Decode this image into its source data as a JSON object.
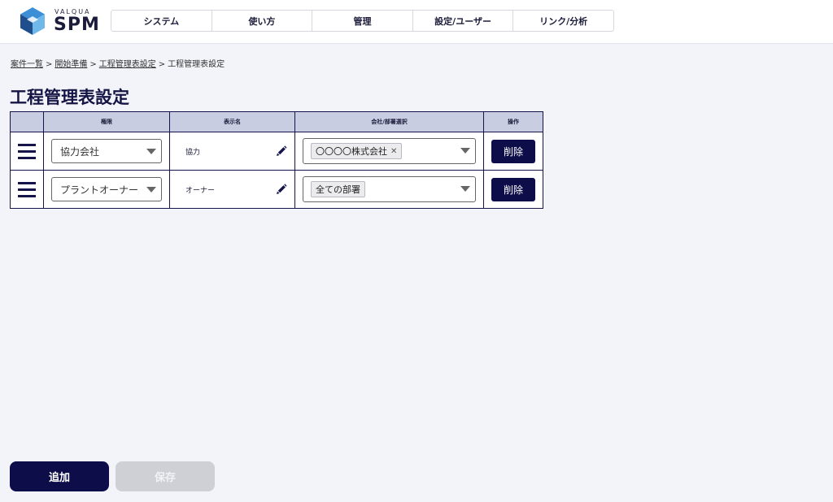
{
  "brand": {
    "sub": "VALQUA",
    "name": "SPM"
  },
  "nav": {
    "items": [
      {
        "label": "システム"
      },
      {
        "label": "使い方"
      },
      {
        "label": "管理"
      },
      {
        "label": "設定/ユーザー"
      },
      {
        "label": "リンク/分析"
      }
    ]
  },
  "breadcrumb": {
    "items": [
      {
        "label": "案件一覧"
      },
      {
        "label": "開始準備"
      },
      {
        "label": "工程管理表設定"
      },
      {
        "label": "工程管理表設定"
      }
    ],
    "separator": ">"
  },
  "page": {
    "title": "工程管理表設定"
  },
  "table": {
    "headers": [
      "",
      "権限",
      "表示名",
      "会社/部署選択",
      "操作"
    ],
    "rows": [
      {
        "role": "協力会社",
        "display_name": "協力",
        "tag": "〇〇〇〇株式会社",
        "tag_removable": true,
        "delete_label": "削除"
      },
      {
        "role": "プラントオーナー",
        "display_name": "オーナー",
        "tag": "全ての部署",
        "tag_removable": false,
        "delete_label": "削除"
      }
    ]
  },
  "footer": {
    "add_label": "追加",
    "save_label": "保存"
  },
  "colors": {
    "navy": "#0d0d4a",
    "header_bg": "#c9cde2",
    "page_bg": "#f3f4f9",
    "disabled": "#cfd0d6"
  },
  "icons": {
    "logo": "cube-logo-icon",
    "drag": "hamburger-icon",
    "edit": "pencil-icon",
    "dropdown": "caret-down-icon",
    "remove": "close-icon"
  }
}
